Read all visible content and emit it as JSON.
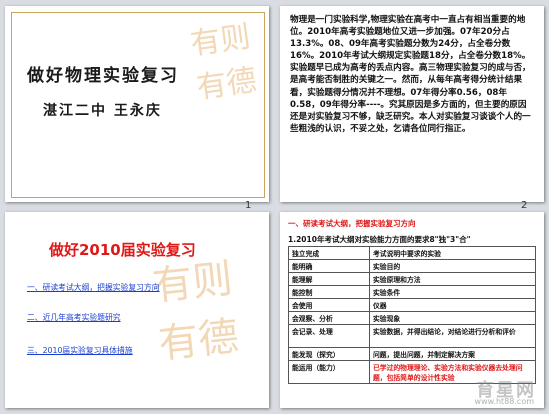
{
  "slides": {
    "s1": {
      "title": "做好物理实验复习",
      "author": "湛江二中  王永庆",
      "number": "1"
    },
    "s2": {
      "body": "物理是一门实验科学,物理实验在高考中一直占有相当重要的地位。2010年高考实验题地位又进一步加强。07年20分占13.3%。08、09年高考实验题分数为24分，占全卷分数16%。2010年考试大纲规定实验题18分，占全卷分数18%。实验题早已成为高考的丢点内容。高三物理实验复习的成与否，是高考能否制胜的关键之一。然而，从每年高考得分统计结果看，实验题得分情况并不理想。07年得分率0.56，08年0.58，09年得分率----。究其原因是多方面的，但主要的原因还是对实验复习不够，缺乏研究。本人对实验复习谈谈个人的一些粗浅的认识，不妥之处，乞请各位同行指正。",
      "number": "2"
    },
    "s3": {
      "title": "做好2010届实验复习",
      "links": [
        "一、研读考试大纲，把握实验复习方向",
        "二、近几年高考实验题研究",
        "三、2010届实验复习具体措施"
      ]
    },
    "s4": {
      "heading": "一、研读考试大纲，把握实验复习方向",
      "subheading": "1.2010年考试大纲对实验能力方面的要求8\"独\"3\"合\"",
      "rows": [
        [
          "独立完成",
          "考试说明中要求的实验"
        ],
        [
          "能明确",
          "实验目的"
        ],
        [
          "能理解",
          "实验原理和方法"
        ],
        [
          "能控制",
          "实验条件"
        ],
        [
          "会使用",
          "仪器"
        ],
        [
          "会观察、分析",
          "实验现象"
        ],
        [
          "会记录、处理",
          "实验数据，并得出结论，对结论进行分析和评价"
        ],
        [
          "能发现（探究）",
          "问题，提出问题，并制定解决方案"
        ],
        [
          "能运用（能力）",
          "已学过的物理理论、实验方法和实验仪器去处理问题，包括简单的设计性实验"
        ]
      ]
    }
  },
  "seal_text": "有则有德",
  "watermark": "育星网",
  "watermark_url": "www.ht88.com"
}
